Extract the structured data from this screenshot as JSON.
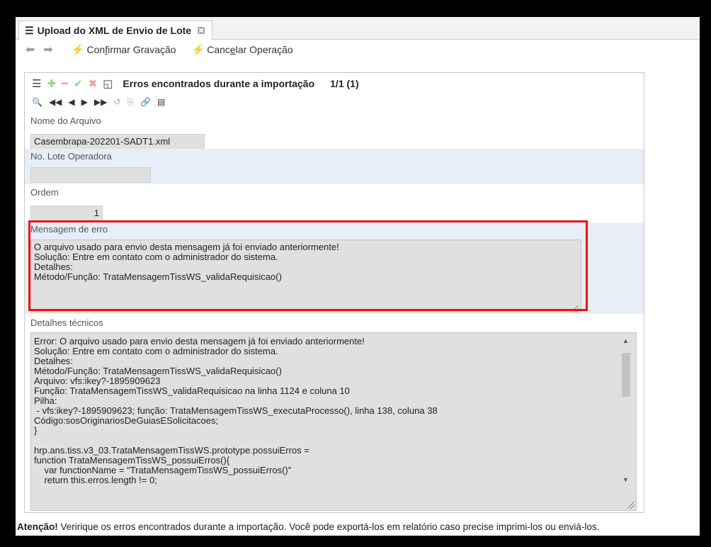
{
  "tab": {
    "title": "Upload do XML de Envio de Lote"
  },
  "toolbar": {
    "confirm": {
      "pre": "Con",
      "u": "f",
      "post": "irmar Gravação"
    },
    "cancel": {
      "pre": "Canc",
      "u": "e",
      "post": "lar Operação"
    }
  },
  "panel": {
    "title": "Erros encontrados durante a importação",
    "count": "1/1 (1)"
  },
  "fields": {
    "file_name": {
      "label": "Nome do Arquivo",
      "value": "Casembrapa-202201-SADT1.xml"
    },
    "batch": {
      "label": "No. Lote Operadora",
      "value": ""
    },
    "order": {
      "label": "Ordem",
      "value": "1"
    },
    "error_message": {
      "label": "Mensagem de erro",
      "value": "O arquivo usado para envio desta mensagem já foi enviado anteriormente!\nSolução: Entre em contato com o administrador do sistema.\nDetalhes:\nMétodo/Função: TrataMensagemTissWS_validaRequisicao()"
    },
    "tech_details": {
      "label": "Detalhes técnicos",
      "value": "Error: O arquivo usado para envio desta mensagem já foi enviado anteriormente!\nSolução: Entre em contato com o administrador do sistema.\nDetalhes:\nMétodo/Função: TrataMensagemTissWS_validaRequisicao()\nArquivo: vfs:ikey?-1895909623\nFunção: TrataMensagemTissWS_validaRequisicao na linha 1124 e coluna 10\nPilha:\n - vfs:ikey?-1895909623; função: TrataMensagemTissWS_executaProcesso(), linha 138, coluna 38\nCódigo:sosOriginariosDeGuiasESolicitacoes;\n}\n\nhrp.ans.tiss.v3_03.TrataMensagemTissWS.prototype.possuiErros =\nfunction TrataMensagemTissWS_possuiErros(){\n    var functionName = \"TrataMensagemTissWS_possuiErros()\"\n    return this.erros.length != 0;"
    }
  },
  "footer": {
    "bold": "Atenção!",
    "text": " Veririque os erros encontrados durante a importação. Você pode exportá-los em relatório caso precise imprimi-los ou enviá-los."
  }
}
